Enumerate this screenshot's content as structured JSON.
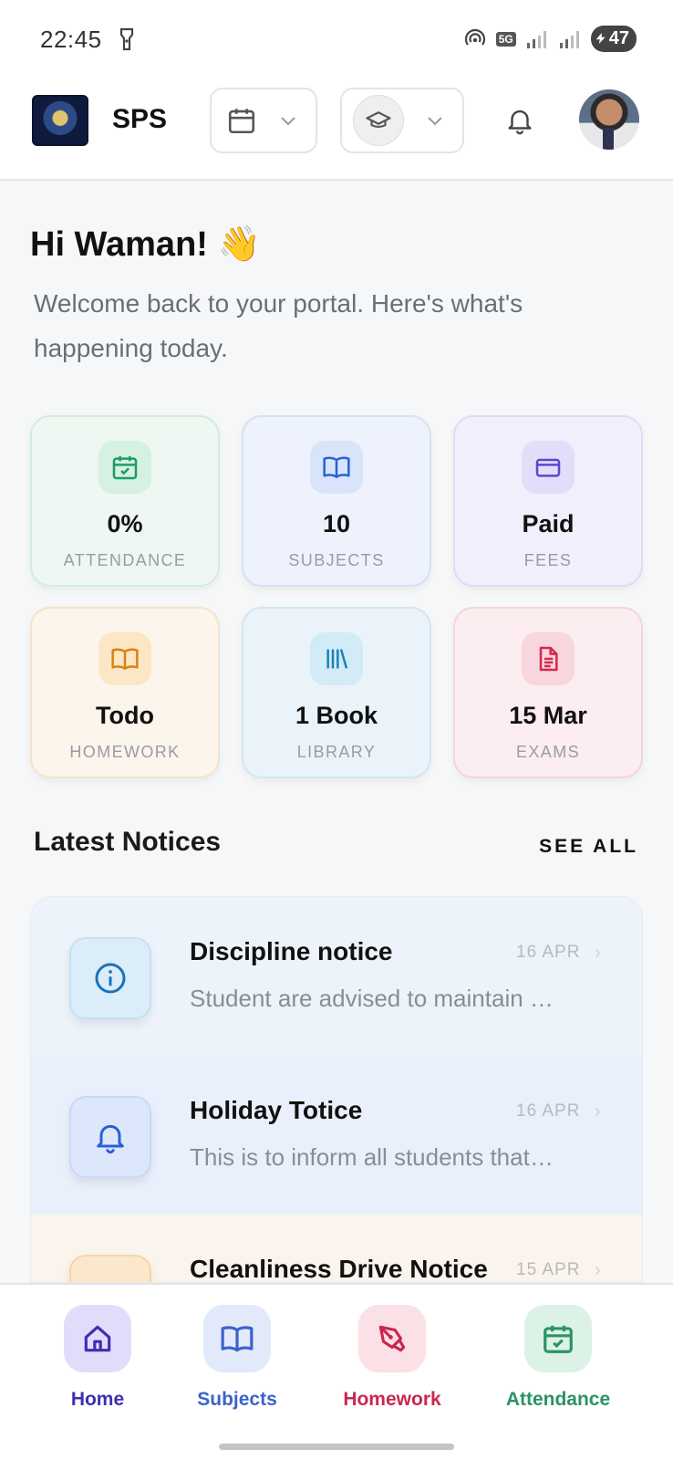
{
  "status_bar": {
    "time": "22:45",
    "network": "5G",
    "battery": "47"
  },
  "header": {
    "app_name": "SPS"
  },
  "greeting": {
    "title": "Hi Waman! 👋",
    "subtitle": "Welcome back to your portal. Here's what's happening today."
  },
  "stats": [
    {
      "value": "0%",
      "label": "ATTENDANCE",
      "icon": "calendar-check-icon",
      "bg": "#eef7f2",
      "border": "#d3ece0",
      "icon_bg": "#d6f0e2",
      "icon_color": "#1f9d63"
    },
    {
      "value": "10",
      "label": "SUBJECTS",
      "icon": "book-icon",
      "bg": "#edf2fc",
      "border": "#d6e1f5",
      "icon_bg": "#d8e4fa",
      "icon_color": "#2a62d6"
    },
    {
      "value": "Paid",
      "label": "FEES",
      "icon": "credit-card-icon",
      "bg": "#f0effc",
      "border": "#dfddf4",
      "icon_bg": "#e1defa",
      "icon_color": "#5b47cf"
    },
    {
      "value": "Todo",
      "label": "HOMEWORK",
      "icon": "book-open-icon",
      "bg": "#fbf5ec",
      "border": "#f2e4cc",
      "icon_bg": "#fbe6c6",
      "icon_color": "#d98310"
    },
    {
      "value": "1 Book",
      "label": "LIBRARY",
      "icon": "library-icon",
      "bg": "#eaf3fa",
      "border": "#d1e6f3",
      "icon_bg": "#d3eaf7",
      "icon_color": "#1a84b8"
    },
    {
      "value": "15 Mar",
      "label": "EXAMS",
      "icon": "document-icon",
      "bg": "#fbedf0",
      "border": "#f3d6dc",
      "icon_bg": "#f8d6de",
      "icon_color": "#d6274e"
    }
  ],
  "notices": {
    "title": "Latest Notices",
    "see_all": "SEE ALL",
    "items": [
      {
        "title": "Discipline notice",
        "desc": "Student are advised to maintain discipline…",
        "date": "16 APR",
        "icon": "info-icon",
        "bg": "#edf3fb",
        "icon_bg": "#dcedfa",
        "icon_border": "#c5e0f5",
        "icon_color": "#1a73b8"
      },
      {
        "title": "Holiday Totice",
        "desc": "This is to inform all students that…",
        "date": "16 APR",
        "icon": "bell-icon",
        "bg": "#e9f0fb",
        "icon_bg": "#dde7fb",
        "icon_border": "#c9d8f6",
        "icon_color": "#2a5fd6"
      },
      {
        "title": "Cleanliness Drive Notice",
        "desc": "",
        "date": "15 APR",
        "icon": "megaphone-icon",
        "bg": "#fbf4ec",
        "icon_bg": "#fbe7c9",
        "icon_border": "#f3d7ab",
        "icon_color": "#d98310"
      }
    ]
  },
  "bottom_nav": [
    {
      "label": "Home",
      "icon": "home-icon",
      "color": "#3d2fb0",
      "bg": "#e2dcfb"
    },
    {
      "label": "Subjects",
      "icon": "book-icon",
      "color": "#3a63c9",
      "bg": "#e1e9fb"
    },
    {
      "label": "Homework",
      "icon": "pen-icon",
      "color": "#c8284f",
      "bg": "#fbe1e6"
    },
    {
      "label": "Attendance",
      "icon": "calendar-check-icon",
      "color": "#2a9462",
      "bg": "#dcf2e6"
    }
  ]
}
